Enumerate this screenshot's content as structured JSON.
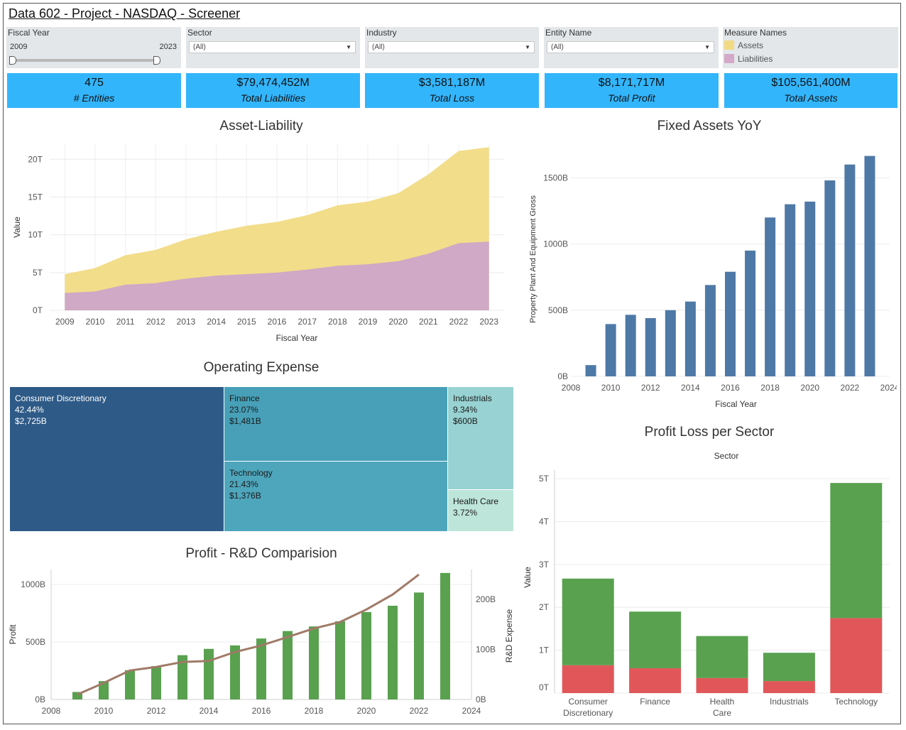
{
  "dashboard": {
    "title": "Data 602 - Project - NASDAQ - Screener"
  },
  "filters": {
    "fiscal_year": {
      "label": "Fiscal Year",
      "min": "2009",
      "max": "2023"
    },
    "sector": {
      "label": "Sector",
      "value": "(All)"
    },
    "industry": {
      "label": "Industry",
      "value": "(All)"
    },
    "entity": {
      "label": "Entity Name",
      "value": "(All)"
    },
    "measures": {
      "label": "Measure Names",
      "items": [
        {
          "name": "Assets",
          "color": "#f2da82"
        },
        {
          "name": "Liabilities",
          "color": "#d4a8c8"
        }
      ]
    }
  },
  "kpis": [
    {
      "value": "475",
      "label": "# Entities"
    },
    {
      "value": "$79,474,452M",
      "label": "Total Liabilities"
    },
    {
      "value": "$3,581,187M",
      "label": "Total Loss"
    },
    {
      "value": "$8,171,717M",
      "label": "Total Profit"
    },
    {
      "value": "$105,561,400M",
      "label": "Total Assets"
    }
  ],
  "colors": {
    "kpi": "#33b5fb",
    "assets": "#f2dd8a",
    "liabilities": "#cfa9c6",
    "fixed_bar": "#4e79a7",
    "profit": "#59a14f",
    "loss": "#e15759",
    "rd_line": "#a07a68"
  },
  "chart_data": [
    {
      "id": "asset_liability",
      "type": "area",
      "title": "Asset-Liability",
      "xlabel": "Fiscal Year",
      "ylabel": "Value",
      "x": [
        2009,
        2010,
        2011,
        2012,
        2013,
        2014,
        2015,
        2016,
        2017,
        2018,
        2019,
        2020,
        2021,
        2022,
        2023
      ],
      "ylim": [
        0,
        22
      ],
      "yticks": [
        "0T",
        "5T",
        "10T",
        "15T",
        "20T"
      ],
      "series": [
        {
          "name": "Assets",
          "values": [
            4.8,
            5.6,
            7.3,
            8.0,
            9.4,
            10.4,
            11.2,
            11.7,
            12.6,
            13.9,
            14.4,
            15.5,
            18.0,
            21.1,
            21.6
          ]
        },
        {
          "name": "Liabilities",
          "values": [
            2.3,
            2.5,
            3.4,
            3.6,
            4.2,
            4.6,
            4.8,
            5.0,
            5.4,
            5.9,
            6.1,
            6.5,
            7.5,
            8.9,
            9.1
          ]
        }
      ]
    },
    {
      "id": "fixed_assets",
      "type": "bar",
      "title": "Fixed Assets YoY",
      "xlabel": "Fiscal Year",
      "ylabel": "Property Plant And Equipment Gross",
      "x": [
        2009,
        2010,
        2011,
        2012,
        2013,
        2014,
        2015,
        2016,
        2017,
        2018,
        2019,
        2020,
        2021,
        2022,
        2023
      ],
      "values": [
        85,
        395,
        465,
        440,
        500,
        565,
        690,
        790,
        950,
        1200,
        1300,
        1320,
        1480,
        1600,
        1665
      ],
      "ylim": [
        0,
        1770
      ],
      "yticks": [
        "0B",
        "500B",
        "1000B",
        "1500B"
      ],
      "xticks": [
        "2008",
        "2010",
        "2012",
        "2014",
        "2016",
        "2018",
        "2020",
        "2022",
        "2024"
      ]
    },
    {
      "id": "operating_expense",
      "type": "treemap",
      "title": "Operating Expense",
      "items": [
        {
          "name": "Consumer Discretionary",
          "pct": "42.44%",
          "value": "$2,725B",
          "color": "#2e5a87"
        },
        {
          "name": "Finance",
          "pct": "23.07%",
          "value": "$1,481B",
          "color": "#47a0b8"
        },
        {
          "name": "Technology",
          "pct": "21.43%",
          "value": "$1,376B",
          "color": "#4ea6bc"
        },
        {
          "name": "Industrials",
          "pct": "9.34%",
          "value": "$600B",
          "color": "#98d2d2"
        },
        {
          "name": "Health Care",
          "pct": "3.72%",
          "value": "",
          "color": "#bde5da"
        }
      ]
    },
    {
      "id": "profit_rd",
      "type": "bar",
      "title": "Profit - R&D Comparision",
      "ylabel": "Profit",
      "y2label": "R&D Expense",
      "x": [
        2009,
        2010,
        2011,
        2012,
        2013,
        2014,
        2015,
        2016,
        2017,
        2018,
        2019,
        2020,
        2021,
        2022,
        2023
      ],
      "series": [
        {
          "name": "Profit",
          "values": [
            65,
            160,
            255,
            290,
            385,
            440,
            470,
            530,
            595,
            635,
            680,
            760,
            815,
            930,
            1100
          ]
        },
        {
          "name": "R&D Expense",
          "values": [
            10,
            33,
            58,
            65,
            75,
            77,
            95,
            108,
            125,
            142,
            155,
            180,
            210,
            250
          ]
        }
      ],
      "ylim": [
        0,
        1130
      ],
      "y2lim": [
        0,
        260
      ],
      "yticks": [
        "0B",
        "500B",
        "1000B"
      ],
      "y2ticks": [
        "0B",
        "100B",
        "200B"
      ],
      "xticks": [
        "2008",
        "2010",
        "2012",
        "2014",
        "2016",
        "2018",
        "2020",
        "2022",
        "2024"
      ]
    },
    {
      "id": "profit_loss_sector",
      "type": "bar",
      "title": "Profit Loss per Sector",
      "subtitle": "Sector",
      "ylabel": "Value",
      "categories": [
        "Consumer Discretionary",
        "Finance",
        "Health Care",
        "Industrials",
        "Technology"
      ],
      "series": [
        {
          "name": "Loss",
          "values": [
            0.65,
            0.58,
            0.35,
            0.28,
            1.75
          ]
        },
        {
          "name": "Profit",
          "values": [
            2.02,
            1.32,
            0.98,
            0.66,
            3.15
          ]
        }
      ],
      "ylim": [
        0,
        5.2
      ],
      "yticks": [
        "0T",
        "1T",
        "2T",
        "3T",
        "4T",
        "5T"
      ]
    }
  ]
}
